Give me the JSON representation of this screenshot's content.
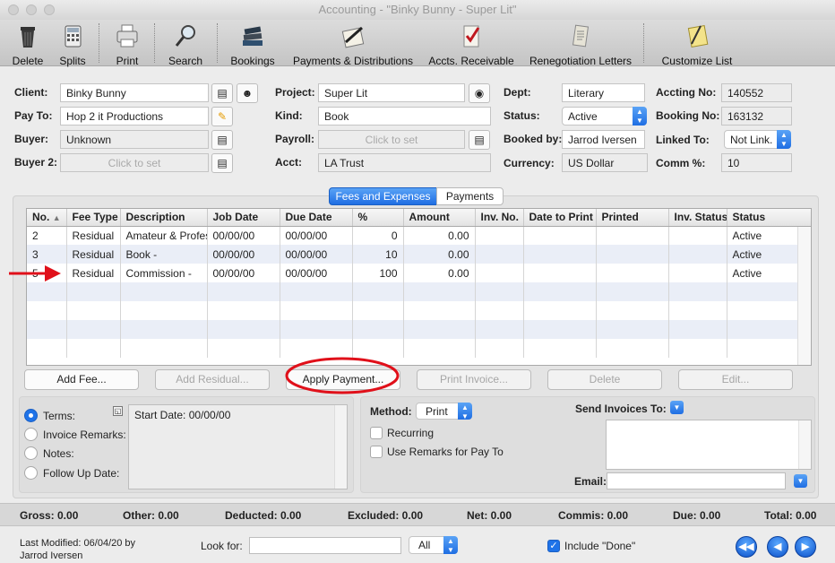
{
  "window": {
    "title": "Accounting - \"Binky Bunny - Super Lit\""
  },
  "toolbar": {
    "items": [
      {
        "label": "Delete",
        "icon": "trash-icon"
      },
      {
        "label": "Splits",
        "icon": "calculator-icon"
      },
      {
        "label": "Print",
        "icon": "printer-icon"
      },
      {
        "label": "Search",
        "icon": "magnifier-icon"
      },
      {
        "label": "Bookings",
        "icon": "books-icon"
      },
      {
        "label": "Payments & Distributions",
        "icon": "pen-paper-icon"
      },
      {
        "label": "Accts. Receivable",
        "icon": "checklist-icon"
      },
      {
        "label": "Renegotiation Letters",
        "icon": "letters-icon"
      },
      {
        "label": "Customize List",
        "icon": "notepad-icon"
      }
    ]
  },
  "form": {
    "client_label": "Client:",
    "client": "Binky Bunny",
    "payto_label": "Pay To:",
    "payto": "Hop 2 it Productions",
    "buyer_label": "Buyer:",
    "buyer": "Unknown",
    "buyer2_label": "Buyer 2:",
    "buyer2_placeholder": "Click to set",
    "project_label": "Project:",
    "project": "Super Lit",
    "kind_label": "Kind:",
    "kind": "Book",
    "payroll_label": "Payroll:",
    "payroll_placeholder": "Click to set",
    "acct_label": "Acct:",
    "acct": "LA Trust",
    "dept_label": "Dept:",
    "dept": "Literary",
    "status_label": "Status:",
    "status": "Active",
    "bookedby_label": "Booked by:",
    "bookedby": "Jarrod Iversen",
    "currency_label": "Currency:",
    "currency": "US Dollar",
    "accting_label": "Accting No:",
    "accting": "140552",
    "booking_label": "Booking No:",
    "booking": "163132",
    "linked_label": "Linked To:",
    "linked": "Not Link.",
    "comm_label": "Comm %:",
    "comm": "10"
  },
  "tabs": {
    "fees": "Fees and Expenses",
    "payments": "Payments"
  },
  "table": {
    "columns": [
      "No.",
      "Fee Type",
      "Description",
      "Job Date",
      "Due Date",
      "%",
      "Amount",
      "Inv. No.",
      "Date to Print",
      "Printed",
      "Inv. Status",
      "Status"
    ],
    "rows": [
      {
        "no": "2",
        "type": "Residual",
        "desc": "Amateur & Professional",
        "job": "00/00/00",
        "due": "00/00/00",
        "pct": "0",
        "amount": "0.00",
        "status": "Active"
      },
      {
        "no": "3",
        "type": "Residual",
        "desc": "Book -",
        "job": "00/00/00",
        "due": "00/00/00",
        "pct": "10",
        "amount": "0.00",
        "status": "Active"
      },
      {
        "no": "5",
        "type": "Residual",
        "desc": "Commission -",
        "job": "00/00/00",
        "due": "00/00/00",
        "pct": "100",
        "amount": "0.00",
        "status": "Active"
      }
    ]
  },
  "buttons": {
    "add_fee": "Add Fee...",
    "add_residual": "Add Residual...",
    "apply_payment": "Apply Payment...",
    "print_invoice": "Print Invoice...",
    "delete": "Delete",
    "edit": "Edit..."
  },
  "notes": {
    "terms": "Terms:",
    "invoice_remarks": "Invoice Remarks:",
    "notes": "Notes:",
    "follow_up": "Follow Up Date:",
    "text": "Start Date: 00/00/00"
  },
  "invoice": {
    "method_label": "Method:",
    "method": "Print",
    "recurring": "Recurring",
    "use_remarks": "Use Remarks for Pay To",
    "send_label": "Send Invoices To:",
    "email_label": "Email:"
  },
  "totals": {
    "gross": "Gross: 0.00",
    "other": "Other: 0.00",
    "deducted": "Deducted: 0.00",
    "excluded": "Excluded: 0.00",
    "net": "Net: 0.00",
    "commis": "Commis: 0.00",
    "due": "Due: 0.00",
    "total": "Total: 0.00"
  },
  "footer": {
    "modified_line1": "Last Modified: 06/04/20 by",
    "modified_line2": "Jarrod Iversen",
    "look_for": "Look for:",
    "filter": "All",
    "include_done": "Include \"Done\""
  },
  "colors": {
    "accent": "#1f73e8",
    "annotation": "#e0101a"
  }
}
